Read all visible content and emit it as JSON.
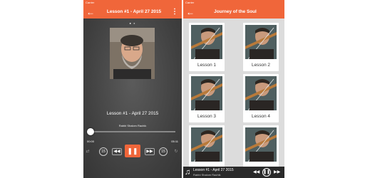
{
  "colors": {
    "accent": "#f0663a",
    "player_bg": "#4a4a4a",
    "grid_bg": "#dcdcdc",
    "mini_player_bg": "#2a2a2a"
  },
  "left": {
    "statusbar": {
      "carrier": "Carrier",
      "time": "",
      "battery": ""
    },
    "header": {
      "back_icon": "arrow-left",
      "title": "Lesson #1 - April 27 2015",
      "more_icon": "vertical-dots"
    },
    "page_dots": [
      "●",
      "●"
    ],
    "now_playing": {
      "title": "Lesson #1 - April 27 2015",
      "artist": "Rabbi Shalom Rachik",
      "progress": 0.0,
      "time_elapsed": "00:00",
      "time_total": "05:11"
    },
    "controls": {
      "shuffle": "⇄",
      "rewind15": "15",
      "prev": "◀◀",
      "play": "❚❚",
      "next": "▶▶",
      "forward15": "15",
      "repeat": "↻"
    }
  },
  "right": {
    "statusbar": {
      "carrier": "Carrier",
      "time": "",
      "battery": ""
    },
    "header": {
      "back_icon": "arrow-left",
      "title": "Journey of the Soul"
    },
    "lessons": [
      {
        "label": "Lesson 1"
      },
      {
        "label": "Lesson 2"
      },
      {
        "label": "Lesson 3"
      },
      {
        "label": "Lesson 4"
      },
      {
        "label": ""
      },
      {
        "label": ""
      }
    ],
    "mini_player": {
      "icon": "♫",
      "title": "Lesson #1 - April 27 2015",
      "artist": "Rabbi Shalom Rachik",
      "prev": "◀◀",
      "play": "❚❚",
      "next": "▶▶"
    }
  }
}
